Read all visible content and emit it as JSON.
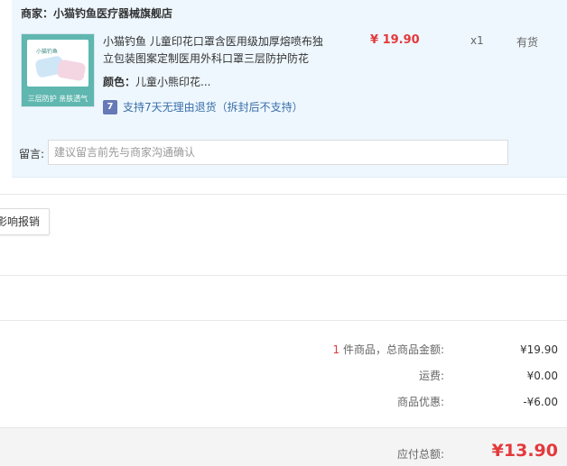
{
  "shop": {
    "label": "商家：",
    "name": "小猫钓鱼医疗器械旗舰店"
  },
  "product": {
    "image_brand": "小猫钓鱼",
    "image_banner": "三层防护 亲肤透气",
    "title": "小猫钓鱼 儿童印花口罩含医用级加厚熔喷布独立包装图案定制医用外科口罩三层防护防花",
    "price": "¥ 19.90",
    "qty": "x1",
    "stock": "有货",
    "attr_key": "颜色：",
    "attr_value": "儿童小熊印花...",
    "return_badge": "7",
    "return_text": "支持7天无理由退货（拆封后不支持）"
  },
  "note": {
    "label": "留言:",
    "placeholder": "建议留言前先与商家沟通确认"
  },
  "reimburse_button": "影响报销",
  "summary": {
    "count": "1",
    "goods_label": " 件商品，总商品金额:",
    "goods_value": "¥19.90",
    "shipping_label": "运费:",
    "shipping_value": "¥0.00",
    "discount_label": "商品优惠:",
    "discount_value": "-¥6.00",
    "total_label": "应付总额:",
    "total_value": "¥13.90"
  },
  "colors": {
    "accent_red": "#e4393c",
    "panel_bg": "#eef7fe",
    "link_blue": "#3a6fa8"
  }
}
